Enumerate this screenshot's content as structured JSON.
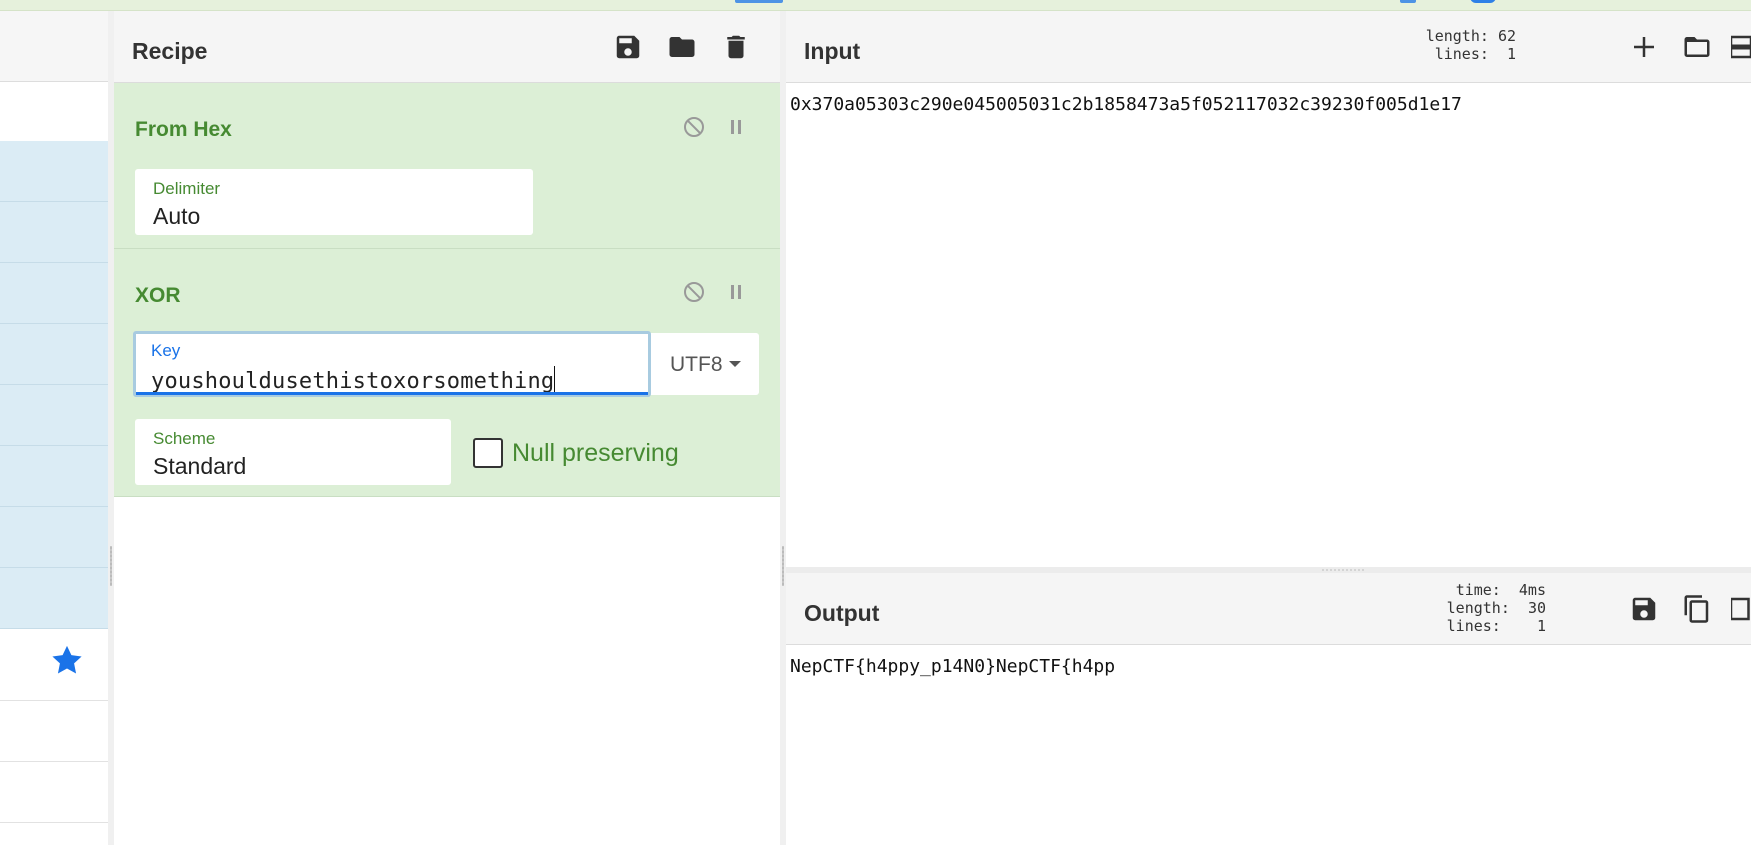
{
  "recipe": {
    "title": "Recipe",
    "operations": [
      {
        "name": "From Hex",
        "delimiter_label": "Delimiter",
        "delimiter_value": "Auto"
      },
      {
        "name": "XOR",
        "key_label": "Key",
        "key_value": "youshouldusethistoxorsomething",
        "key_encoding": "UTF8",
        "scheme_label": "Scheme",
        "scheme_value": "Standard",
        "null_preserving_label": "Null preserving",
        "null_preserving_checked": false
      }
    ]
  },
  "input": {
    "title": "Input",
    "length_label": "length:",
    "length_value": "62",
    "lines_label": "lines:",
    "lines_value": "1",
    "text": "0x370a05303c290e045005031c2b1858473a5f052117032c39230f005d1e17"
  },
  "output": {
    "title": "Output",
    "time_label": "time:",
    "time_value": "4ms",
    "length_label": "length:",
    "length_value": "30",
    "lines_label": "lines:",
    "lines_value": "1",
    "text": "NepCTF{h4ppy_p14N0}NepCTF{h4pp"
  },
  "icons": {
    "recipe_toolbar": [
      "save-icon",
      "folder-icon",
      "trash-icon"
    ],
    "input_toolbar": [
      "plus-icon",
      "folder-icon",
      "layout-icon"
    ],
    "output_toolbar": [
      "save-icon",
      "copy-icon",
      "replace-icon"
    ],
    "operation_controls": [
      "disable-icon",
      "pause-icon"
    ],
    "favourite": "star-icon"
  },
  "colors": {
    "op_background": "#dcefd6",
    "op_title": "#468a32",
    "accent_blue": "#1a73e8",
    "category_background": "#dbecf5"
  }
}
